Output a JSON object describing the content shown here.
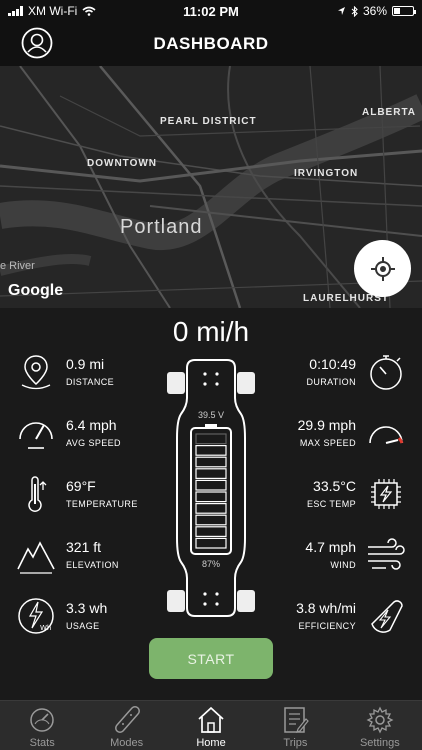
{
  "status_bar": {
    "carrier": "XM Wi-Fi",
    "time": "11:02 PM",
    "battery": "36%",
    "battery_level": 0.36
  },
  "header": {
    "title": "DASHBOARD"
  },
  "map": {
    "labels": {
      "pearl_district": "PEARL DISTRICT",
      "alberta": "ALBERTA",
      "downtown": "DOWNTOWN",
      "irvington": "IRVINGTON",
      "portland": "Portland",
      "river": "e River",
      "laurelhurst": "LAURELHURST",
      "google": "Google"
    }
  },
  "speed": "0 mi/h",
  "metrics": {
    "distance": {
      "value": "0.9 mi",
      "label": "DISTANCE"
    },
    "avg_speed": {
      "value": "6.4 mph",
      "label": "AVG SPEED"
    },
    "temperature": {
      "value": "69°F",
      "label": "TEMPERATURE"
    },
    "elevation": {
      "value": "321 ft",
      "label": "ELEVATION"
    },
    "usage": {
      "value": "3.3 wh",
      "label": "USAGE"
    },
    "duration": {
      "value": "0:10:49",
      "label": "DURATION"
    },
    "max_speed": {
      "value": "29.9 mph",
      "label": "MAX SPEED"
    },
    "esc_temp": {
      "value": "33.5°C",
      "label": "ESC TEMP"
    },
    "wind": {
      "value": "4.7 mph",
      "label": "WIND"
    },
    "efficiency": {
      "value": "3.8 wh/mi",
      "label": "EFFICIENCY"
    }
  },
  "board": {
    "voltage": "39.5 V",
    "battery_percent": "87%",
    "battery_level": 0.87
  },
  "start_label": "START",
  "usage_badge": "Wh",
  "tabs": [
    {
      "label": "Stats",
      "icon": "speedometer-icon"
    },
    {
      "label": "Modes",
      "icon": "skateboard-icon"
    },
    {
      "label": "Home",
      "icon": "home-icon"
    },
    {
      "label": "Trips",
      "icon": "trips-icon"
    },
    {
      "label": "Settings",
      "icon": "gear-icon"
    }
  ],
  "colors": {
    "accent_green": "#7db46c",
    "background": "#1a1a1a",
    "map": "#262626"
  }
}
